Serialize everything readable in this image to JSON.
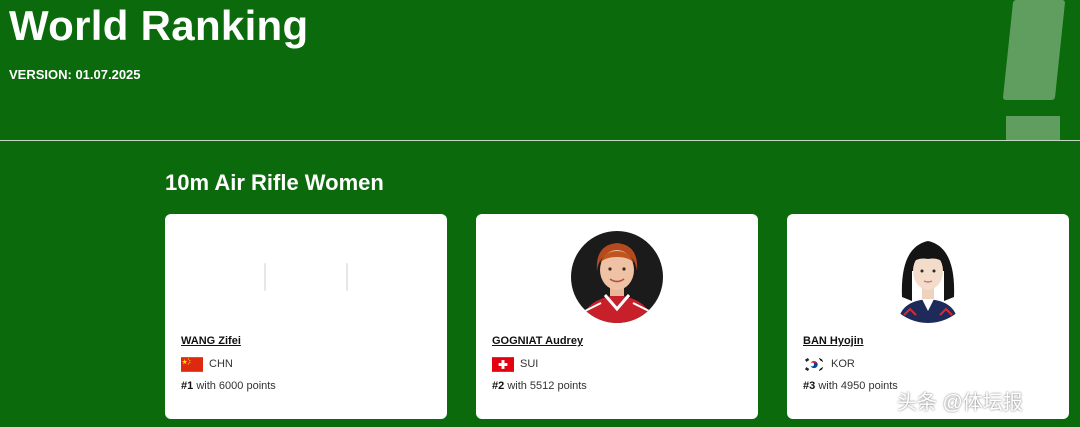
{
  "header": {
    "title": "World Ranking",
    "version": "VERSION: 01.07.2025"
  },
  "event": {
    "title": "10m Air Rifle Women"
  },
  "athletes": [
    {
      "name": "WANG Zifei",
      "nation": "CHN",
      "rank": "#1",
      "points_text": "with 6000 points"
    },
    {
      "name": "GOGNIAT Audrey",
      "nation": "SUI",
      "rank": "#2",
      "points_text": "with 5512 points"
    },
    {
      "name": "BAN Hyojin",
      "nation": "KOR",
      "rank": "#3",
      "points_text": "with 4950 points"
    }
  ],
  "watermark": "头条 @体坛报",
  "colors": {
    "background": "#0b6a0b",
    "card": "#ffffff",
    "text": "#ffffff"
  }
}
